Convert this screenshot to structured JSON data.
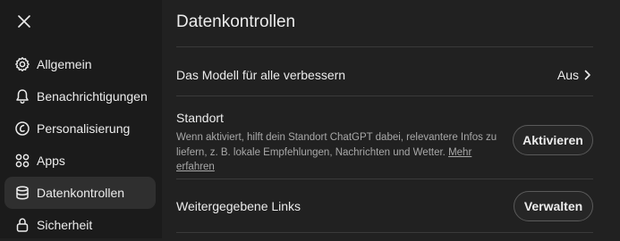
{
  "sidebar": {
    "close_icon": "close-icon",
    "items": [
      {
        "label": "Allgemein",
        "icon": "gear-icon"
      },
      {
        "label": "Benachrichtigungen",
        "icon": "bell-icon"
      },
      {
        "label": "Personalisierung",
        "icon": "personalization-icon"
      },
      {
        "label": "Apps",
        "icon": "apps-grid-icon"
      },
      {
        "label": "Datenkontrollen",
        "icon": "database-icon",
        "active": true
      },
      {
        "label": "Sicherheit",
        "icon": "lock-icon"
      }
    ]
  },
  "main": {
    "title": "Datenkontrollen",
    "improve_model": {
      "label": "Das Modell für alle verbessern",
      "value": "Aus"
    },
    "location": {
      "label": "Standort",
      "description": "Wenn aktiviert, hilft dein Standort ChatGPT dabei, relevantere Infos zu liefern, z. B. lokale Empfehlungen, Nachrichten und Wetter.",
      "link_text": "Mehr erfahren",
      "button": "Aktivieren"
    },
    "shared_links": {
      "label": "Weitergegebene Links",
      "button": "Verwalten"
    }
  },
  "colors": {
    "background": "#212121",
    "sidebar": "#1b1b1b",
    "active_item": "#2f2f2f",
    "text": "#ececec",
    "muted": "#a8a8a8"
  }
}
